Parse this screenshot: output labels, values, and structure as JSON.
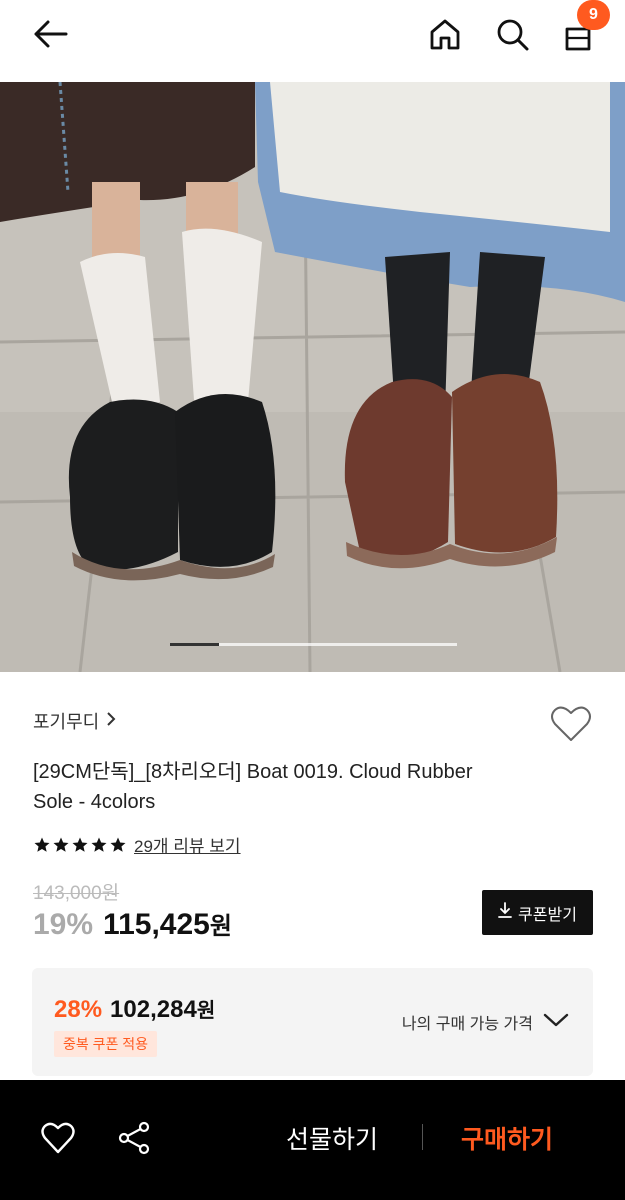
{
  "header": {
    "cart_count": "9",
    "icons": [
      "back-arrow-icon",
      "home-icon",
      "search-icon",
      "cart-icon"
    ]
  },
  "gallery": {
    "current_index": 1,
    "progress_fraction": 0.17
  },
  "product": {
    "brand": "포기무디",
    "title": "[29CM단독]_[8차리오더] Boat 0019. Cloud Rubber Sole - 4colors",
    "rating_stars": 5,
    "review_link": "29개 리뷰 보기",
    "original_price": "143,000원",
    "discount_rate": "19%",
    "sale_price": "115,425",
    "currency": "원",
    "coupon_button": "쿠폰받기"
  },
  "best_price": {
    "rate": "28%",
    "price": "102,284",
    "currency": "원",
    "badge": "중복 쿠폰 적용",
    "toggle_label": "나의 구매 가능 가격"
  },
  "bottom_bar": {
    "gift_label": "선물하기",
    "buy_label": "구매하기"
  },
  "colors": {
    "accent": "#ff5a1f",
    "dark": "#111111",
    "price_grey": "#aaaaaa"
  }
}
